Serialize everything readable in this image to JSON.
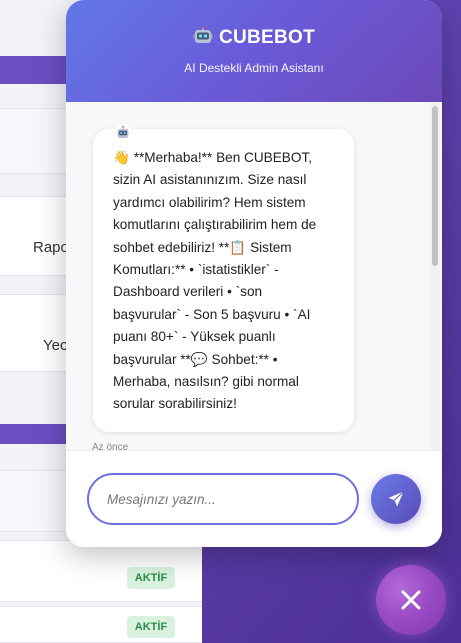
{
  "background_page": {
    "rows": [
      {
        "label": "Rapo"
      },
      {
        "label": "Yec"
      }
    ],
    "badges": [
      "AKTİF",
      "AKTİF"
    ]
  },
  "chat": {
    "title": "CUBEBOT",
    "title_icon": "robot-icon",
    "subtitle": "AI Destekli Admin Asistanı",
    "messages": [
      {
        "sender": "bot",
        "avatar_icon": "robot-icon",
        "text": "👋 **Merhaba!** Ben CUBEBOT,\nsizin AI asistanınızım. Size nasıl\nyardımcı olabilirim? Hem sistem\nkomutlarını çalıştırabilirim hem de\nsohbet edebiliriz! **📋 Sistem\nKomutları:** • `istatistikler` -\nDashboard verileri • `son\nbaşvurular` - Son 5 başvuru • `AI\npuanı 80+` - Yüksek puanlı\nbaşvurular **💬 Sohbet:** •\nMerhaba, nasılsın? gibi normal\nsorular sorabilirsiniz!",
        "time": "Az önce"
      }
    ],
    "input": {
      "placeholder": "Mesajınızı yazın...",
      "value": ""
    },
    "send_icon": "send-icon",
    "close_icon": "close-icon"
  },
  "colors": {
    "header_gradient_start": "#6278e8",
    "header_gradient_end": "#6c49b8",
    "accent": "#6a72e0",
    "badge_bg": "#d8f2df",
    "badge_text": "#2e8a4a"
  }
}
